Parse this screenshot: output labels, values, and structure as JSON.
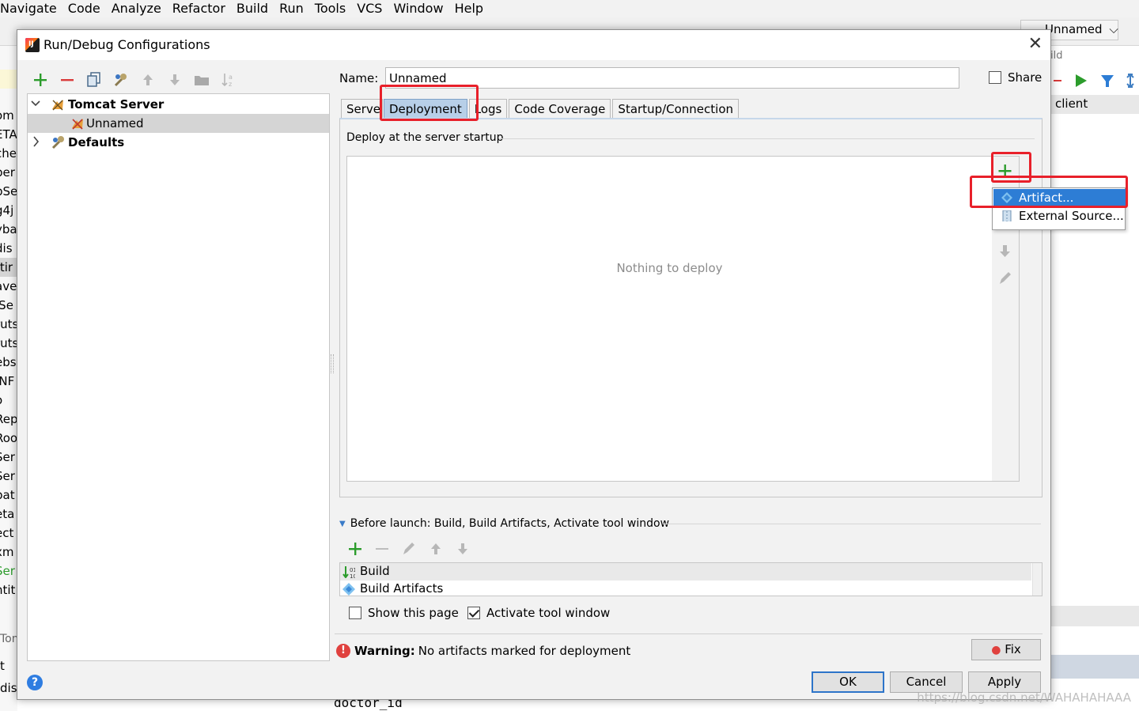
{
  "menu": [
    "Navigate",
    "Code",
    "Analyze",
    "Refactor",
    "Build",
    "Run",
    "Tools",
    "VCS",
    "Window",
    "Help"
  ],
  "ide": {
    "run_config": "Unnamed",
    "right_label1": "ild",
    "right_header": "client",
    "left_fragments": [
      "om",
      "ETA",
      "che",
      "ber",
      "pSe",
      "g4j",
      "yba",
      "dis",
      "ttir",
      "ave",
      "lSe",
      "ruts",
      "ruts",
      "ebs",
      "INF",
      "o",
      "Rep",
      "Roo",
      "Ser",
      "Ser",
      "pat",
      "eta",
      "ect",
      "xm",
      "Ser",
      "ntit"
    ],
    "bottom_left": [
      "Tom",
      "t",
      "disS"
    ],
    "code_fragment": "doctor_id",
    "watermark": "https://blog.csdn.net/WAHAHAHAAA"
  },
  "dialog": {
    "title": "Run/Debug Configurations",
    "close_glyph": "✕",
    "tree": {
      "tomcat_server": "Tomcat Server",
      "unnamed": "Unnamed",
      "defaults": "Defaults"
    },
    "name_label": "Name:",
    "name_value": "Unnamed",
    "share_label": "Share",
    "share_checked": false,
    "tabs": [
      "Server",
      "Deployment",
      "Logs",
      "Code Coverage",
      "Startup/Connection"
    ],
    "active_tab": "Deployment",
    "deploy_group_title": "Deploy at the server startup",
    "nothing_to_deploy": "Nothing to deploy",
    "add_popup": [
      "Artifact...",
      "External Source..."
    ],
    "before_launch_title": "Before launch: Build, Build Artifacts, Activate tool window",
    "before_launch_items": [
      "Build",
      "Build Artifacts"
    ],
    "show_this_page": "Show this page",
    "show_this_page_checked": false,
    "activate_tool_window": "Activate tool window",
    "activate_tool_window_checked": true,
    "warning_bold": "Warning:",
    "warning_text": "No artifacts marked for deployment",
    "fix_button": "Fix",
    "ok_button": "OK",
    "cancel_button": "Cancel",
    "apply_button": "Apply",
    "help_glyph": "?"
  },
  "colors": {
    "green_add": "#2c9c2c",
    "red_remove": "#d93a3a",
    "selection_blue": "#2d7dd5",
    "active_tab": "#b7cfe8",
    "annotation_red": "#e8202a"
  }
}
